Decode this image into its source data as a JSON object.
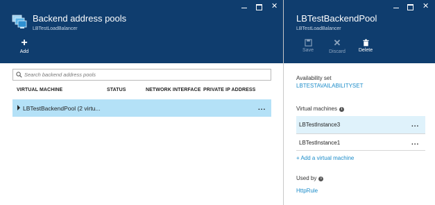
{
  "left_blade": {
    "title": "Backend address pools",
    "subtitle": "LBTestLoadBalancer",
    "commands": {
      "add_label": "Add"
    },
    "search": {
      "placeholder": "Search backend address pools"
    },
    "columns": [
      "VIRTUAL MACHINE",
      "STATUS",
      "NETWORK INTERFACE",
      "PRIVATE IP ADDRESS"
    ],
    "rows": [
      {
        "name": "LBTestBackendPool (2 virtu...",
        "more": "..."
      }
    ],
    "window_controls": [
      "minimize-icon",
      "maximize-icon",
      "close-icon"
    ]
  },
  "right_blade": {
    "title": "LBTestBackendPool",
    "subtitle": "LBTestLoadBalancer",
    "commands": {
      "save_label": "Save",
      "discard_label": "Discard",
      "delete_label": "Delete"
    },
    "availability_set": {
      "label": "Availability set",
      "value": "LBTESTAVAILABILITYSET"
    },
    "virtual_machines": {
      "label": "Virtual machines",
      "items": [
        {
          "name": "LBTestInstance3",
          "more": "..."
        },
        {
          "name": "LBTestInstance1",
          "more": "..."
        }
      ],
      "add_link": "+ Add a virtual machine"
    },
    "used_by": {
      "label": "Used by",
      "value": "HttpRule"
    },
    "window_controls": [
      "minimize-icon",
      "maximize-icon",
      "close-icon"
    ]
  },
  "colors": {
    "header_bg": "#0f3d6e",
    "selected_row": "#b4e1f7",
    "selected_vm_row": "#dff2fb",
    "link": "#1a8bc9"
  }
}
